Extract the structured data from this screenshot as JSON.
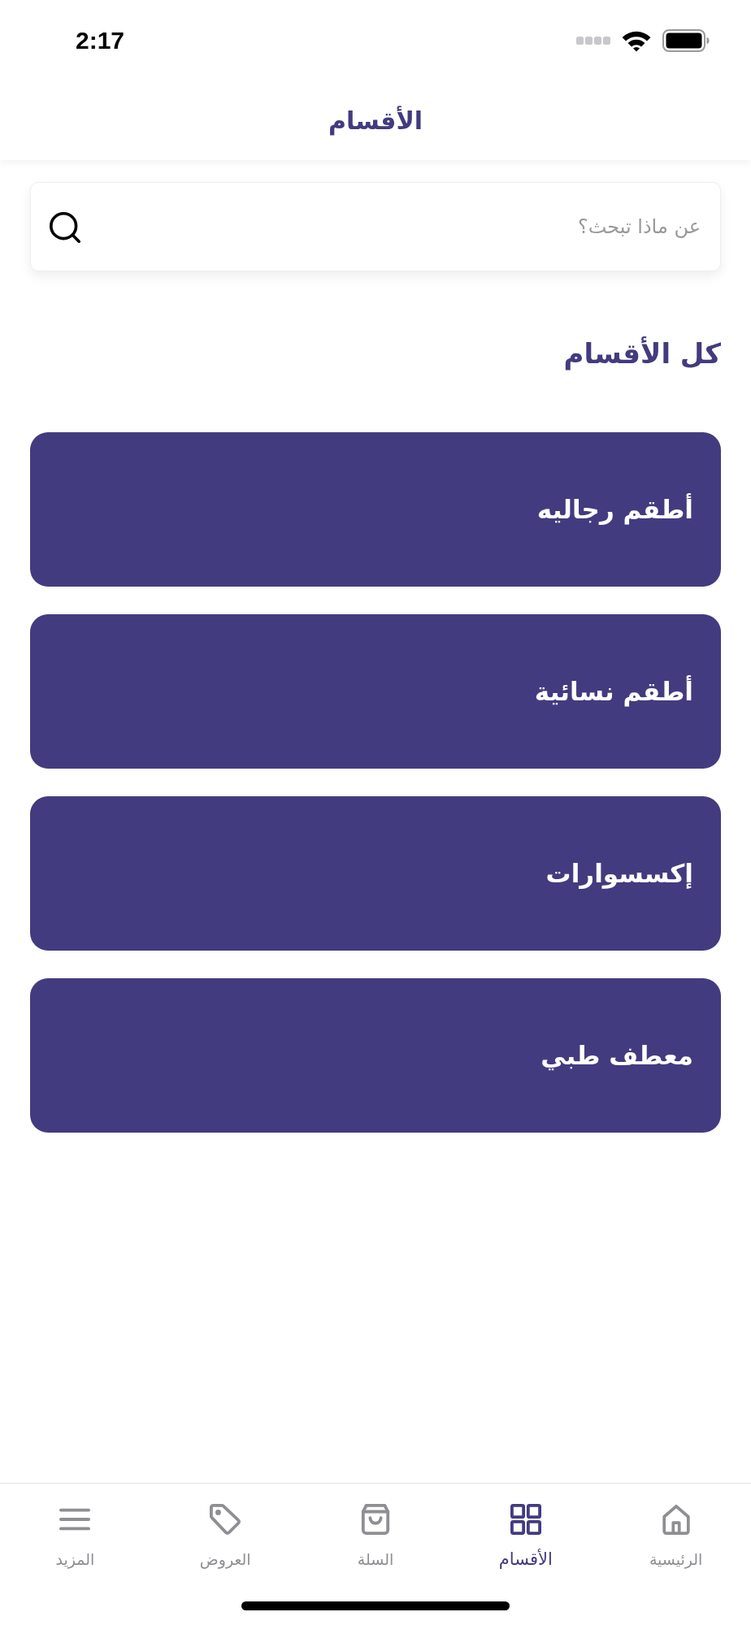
{
  "status_bar": {
    "time": "2:17"
  },
  "header": {
    "title": "الأقسام"
  },
  "search": {
    "placeholder": "عن ماذا تبحث؟"
  },
  "section": {
    "title": "كل الأقسام"
  },
  "categories": [
    {
      "name": "أطقم رجاليه"
    },
    {
      "name": "أطقم نسائية"
    },
    {
      "name": "إكسسوارات"
    },
    {
      "name": "معطف طبي"
    }
  ],
  "tab_bar": [
    {
      "label": "الرئيسية",
      "kind": "home",
      "selected": false
    },
    {
      "label": "الأقسام",
      "kind": "grid",
      "selected": true
    },
    {
      "label": "السلة",
      "kind": "bag",
      "selected": false
    },
    {
      "label": "العروض",
      "kind": "tag",
      "selected": false
    },
    {
      "label": "المزيد",
      "kind": "menu",
      "selected": false
    }
  ]
}
